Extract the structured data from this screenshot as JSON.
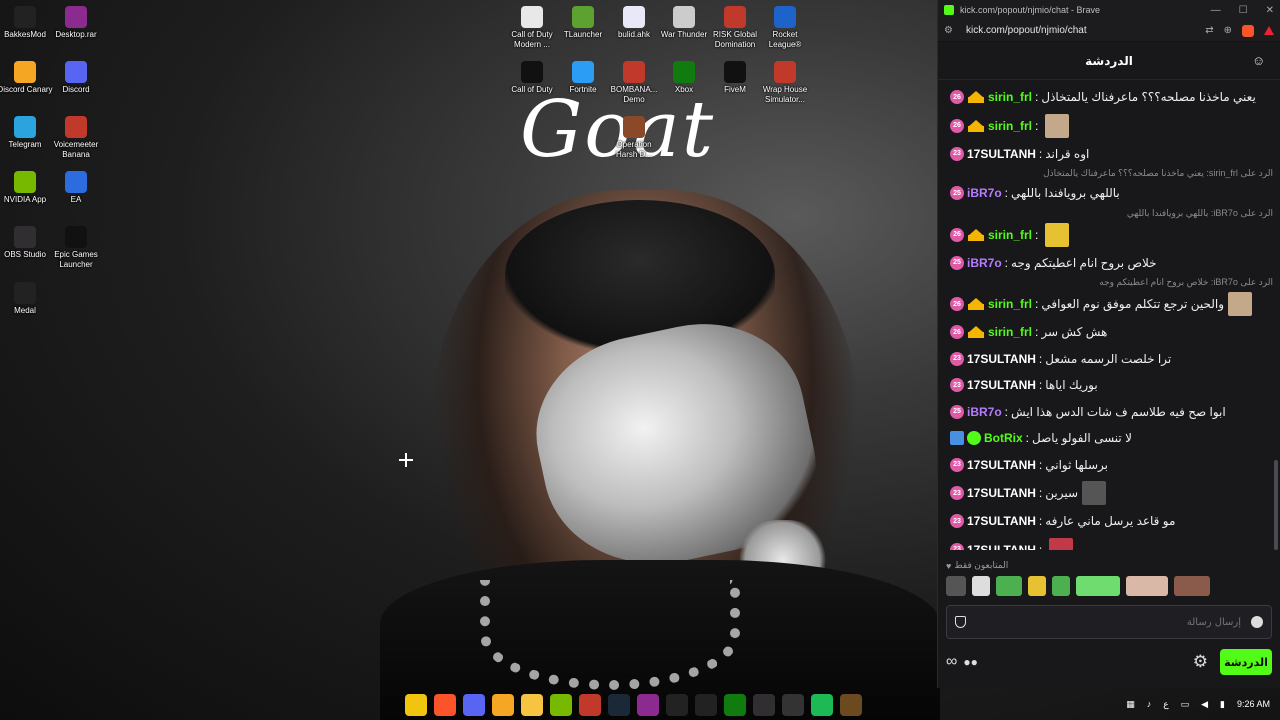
{
  "desktop": {
    "wallpaper_text": "Goat",
    "icons": [
      {
        "label": "BakkesMod",
        "icon": "bakkesmod-icon",
        "color": "#222"
      },
      {
        "label": "Desktop.rar",
        "icon": "winrar-icon",
        "color": "#8b2b8f"
      },
      {
        "label": "Discord Canary",
        "icon": "discord-canary-icon",
        "color": "#f5a623"
      },
      {
        "label": "Discord",
        "icon": "discord-icon",
        "color": "#5865f2"
      },
      {
        "label": "Telegram",
        "icon": "telegram-icon",
        "color": "#2aa3df"
      },
      {
        "label": "Voicemeeter Banana",
        "icon": "voicemeeter-icon",
        "color": "#c0392b"
      },
      {
        "label": "NVIDIA App",
        "icon": "nvidia-icon",
        "color": "#76b900"
      },
      {
        "label": "EA",
        "icon": "ea-icon",
        "color": "#2d6cdf"
      },
      {
        "label": "OBS Studio",
        "icon": "obs-icon",
        "color": "#302e31"
      },
      {
        "label": "Epic Games Launcher",
        "icon": "epic-games-icon",
        "color": "#111"
      },
      {
        "label": "Medal",
        "icon": "medal-icon",
        "color": "#222"
      },
      {
        "label": "Call of Duty Modern ...",
        "icon": "document-icon",
        "color": "#e8e8e8"
      },
      {
        "label": "TLauncher",
        "icon": "tlauncher-icon",
        "color": "#5da130"
      },
      {
        "label": "bulid.ahk",
        "icon": "ahk-script-icon",
        "color": "#e8e8f8"
      },
      {
        "label": "War Thunder",
        "icon": "war-thunder-icon",
        "color": "#ccc"
      },
      {
        "label": "RISK Global Domination",
        "icon": "risk-icon",
        "color": "#c0392b"
      },
      {
        "label": "Rocket League®",
        "icon": "rocket-league-icon",
        "color": "#1e63c9"
      },
      {
        "label": "Call of Duty",
        "icon": "call-of-duty-icon",
        "color": "#111"
      },
      {
        "label": "Fortnite",
        "icon": "fortnite-icon",
        "color": "#2b9df4"
      },
      {
        "label": "BOMBANA... Demo",
        "icon": "bombana-icon",
        "color": "#c0392b"
      },
      {
        "label": "Xbox",
        "icon": "xbox-icon",
        "color": "#107c10"
      },
      {
        "label": "FiveM",
        "icon": "fivem-icon",
        "color": "#111"
      },
      {
        "label": "Wrap House Simulator...",
        "icon": "wrap-house-icon",
        "color": "#c0392b"
      },
      {
        "label": "Operation Harsh D...",
        "icon": "operation-harsh-icon",
        "color": "#8a4a2a"
      }
    ]
  },
  "browser": {
    "title": "kick.com/popout/njmio/chat - Brave",
    "url": "kick.com/popout/njmio/chat",
    "brave_count": "1"
  },
  "chat": {
    "header_title": "الدردشة",
    "followers_only_label": "المتابعون فقط",
    "input_placeholder": "إرسال رسالة",
    "send_label": "الدردشة",
    "colors": {
      "green": "#53fc18",
      "pink": "#e05aa8",
      "purple": "#b57cff",
      "gold": "#f5b500"
    },
    "messages": [
      {
        "badge": "26",
        "crown": true,
        "user": "sirin_frl",
        "user_color": "#53fc18",
        "text": "يعني ماخذنا مصلحه؟؟؟ ماعرفناك يالمتخاذل",
        "emote": null,
        "reply": null
      },
      {
        "badge": "26",
        "crown": true,
        "user": "sirin_frl",
        "user_color": "#53fc18",
        "text": "",
        "emote": "#c4a88a",
        "reply": null
      },
      {
        "badge": "23",
        "crown": false,
        "user": "17SULTANH",
        "user_color": "#ffffff",
        "text": "اوه قراند",
        "emote": null,
        "reply": null
      },
      {
        "badge": "25",
        "crown": false,
        "user": "iBR7o",
        "user_color": "#b57cff",
        "text": "باللهي برويافندا باللهي",
        "emote": null,
        "reply": "الرد على sirin_frl: يعني ماخذنا مصلحه؟؟؟ ماعرفناك يالمتخاذل"
      },
      {
        "badge": "26",
        "crown": true,
        "user": "sirin_frl",
        "user_color": "#53fc18",
        "text": "",
        "emote": "#e6c233",
        "reply": "الرد على iBR7o: باللهي برويافندا باللهي"
      },
      {
        "badge": "25",
        "crown": false,
        "user": "iBR7o",
        "user_color": "#b57cff",
        "text": "خلاص بروح انام اعطيتكم وجه",
        "emote": null,
        "reply": null
      },
      {
        "badge": "26",
        "crown": true,
        "user": "sirin_frl",
        "user_color": "#53fc18",
        "text": "والحين ترجع تتكلم موفق نوم العوافي",
        "emote": "#c4a88a",
        "reply": "الرد على iBR7o: خلاص بروح انام اعطيتكم وجه"
      },
      {
        "badge": "26",
        "crown": true,
        "user": "sirin_frl",
        "user_color": "#53fc18",
        "text": "هش كش سر",
        "emote": null,
        "reply": null
      },
      {
        "badge": "23",
        "crown": false,
        "user": "17SULTANH",
        "user_color": "#ffffff",
        "text": "ترا خلصت الرسمه مشعل",
        "emote": null,
        "reply": null
      },
      {
        "badge": "23",
        "crown": false,
        "user": "17SULTANH",
        "user_color": "#ffffff",
        "text": "بوريك اياها",
        "emote": null,
        "reply": null
      },
      {
        "badge": "25",
        "crown": false,
        "user": "iBR7o",
        "user_color": "#b57cff",
        "text": "ابوا صح فيه طلاسم ف شات الدس هذا ايش",
        "emote": null,
        "reply": null
      },
      {
        "badge": "bot",
        "crown": false,
        "user": "BotRix",
        "user_color": "#53fc18",
        "text": "لا تنسى الفولو ياصل",
        "emote": null,
        "reply": null
      },
      {
        "badge": "23",
        "crown": false,
        "user": "17SULTANH",
        "user_color": "#ffffff",
        "text": "برسلها ثواني",
        "emote": null,
        "reply": null
      },
      {
        "badge": "23",
        "crown": false,
        "user": "17SULTANH",
        "user_color": "#ffffff",
        "text": "سيرين",
        "emote": "#555555",
        "reply": null
      },
      {
        "badge": "23",
        "crown": false,
        "user": "17SULTANH",
        "user_color": "#ffffff",
        "text": "مو قاعد يرسل ماني عارفه",
        "emote": null,
        "reply": null
      },
      {
        "badge": "23",
        "crown": false,
        "user": "17SULTANH",
        "user_color": "#ffffff",
        "text": "",
        "emote": "#c23a4a",
        "reply": null
      }
    ],
    "emote_bar": [
      {
        "name": "emote-1",
        "color": "#555",
        "w": 20
      },
      {
        "name": "emote-2",
        "color": "#ddd",
        "w": 18
      },
      {
        "name": "emote-pepe",
        "color": "#4caf50",
        "w": 26
      },
      {
        "name": "emote-4",
        "color": "#e6c233",
        "w": 18
      },
      {
        "name": "emote-5",
        "color": "#4caf50",
        "w": 18
      },
      {
        "name": "emote-6",
        "color": "#6fdc6f",
        "w": 44
      },
      {
        "name": "emote-7",
        "color": "#d9b8a8",
        "w": 42
      },
      {
        "name": "emote-8",
        "color": "#8a5a4a",
        "w": 36
      }
    ]
  },
  "taskbar": {
    "apps": [
      {
        "name": "chrome-taskbar-icon",
        "color": "#f1c40f"
      },
      {
        "name": "brave-taskbar-icon",
        "color": "#fb542b"
      },
      {
        "name": "discord-taskbar-icon",
        "color": "#5865f2"
      },
      {
        "name": "discord-canary-taskbar-icon",
        "color": "#f5a623"
      },
      {
        "name": "file-explorer-taskbar-icon",
        "color": "#f5c542"
      },
      {
        "name": "nvidia-taskbar-icon",
        "color": "#76b900"
      },
      {
        "name": "voicemeeter-taskbar-icon",
        "color": "#c0392b"
      },
      {
        "name": "steam-taskbar-icon",
        "color": "#1b2838"
      },
      {
        "name": "winrar-taskbar-icon",
        "color": "#8b2b8f"
      },
      {
        "name": "terminal-taskbar-icon",
        "color": "#222"
      },
      {
        "name": "epic-taskbar-icon",
        "color": "#222"
      },
      {
        "name": "xbox-taskbar-icon",
        "color": "#107c10"
      },
      {
        "name": "obs-taskbar-icon",
        "color": "#302e31"
      },
      {
        "name": "medal-taskbar-icon",
        "color": "#333"
      },
      {
        "name": "spotify-taskbar-icon",
        "color": "#1db954"
      },
      {
        "name": "media-taskbar-icon",
        "color": "#6b4a1f"
      }
    ],
    "language": "ع",
    "time": "9:26 AM"
  }
}
